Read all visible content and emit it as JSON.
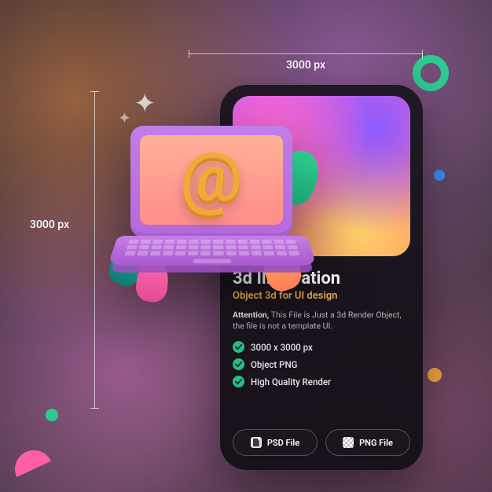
{
  "dimensions": {
    "width_label": "3000 px",
    "height_label": "3000 px"
  },
  "card": {
    "title": "3d Illustration",
    "subtitle": "Object 3d for UI design",
    "desc_bold": "Attention,",
    "desc_rest": " This File is Just a 3d Render Object, the file is not a template UI.",
    "features": [
      "3000 x 3000 px",
      "Object PNG",
      "High Quality Render"
    ],
    "buttons": {
      "psd": "PSD File",
      "png": "PNG File"
    }
  },
  "object": {
    "symbol": "@"
  }
}
